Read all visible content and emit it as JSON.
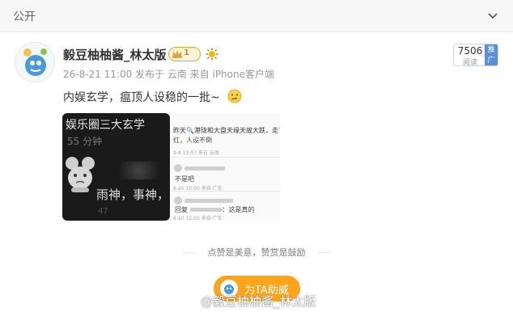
{
  "visibility": "公开",
  "user": {
    "name": "毅豆柚柚酱_林太版",
    "crown_level": "1"
  },
  "post": {
    "meta": "26-8-21 11:00 发布于 云南  来自 iPhone客户端",
    "text": "内娱玄学，瘟顶人设稳的一批~",
    "images": [
      {
        "title": "娱乐圈三大玄学",
        "sub": "55 分钟",
        "caption": "雨神，事神，",
        "foot": "47"
      },
      {
        "line1": "昨天🔍港珑和大盘天缘天故大跌，走了",
        "line1b": "红，人设不倒",
        "meta1": "9-8 13:07 来自 云南",
        "line2": "不是吧",
        "meta2": "8-20 10:00 来自 广东",
        "line3": "回复 ",
        "line3b": "：这是真的",
        "meta3": "8-20 12:00 来自 广东"
      }
    ]
  },
  "reads": {
    "count": "7506",
    "label": "阅读",
    "button": "推广"
  },
  "divider_text": "点赞是美意，赞赏是鼓励",
  "boost_label": "为TA助威",
  "watermark": "@毅豆柚柚酱_林太版",
  "icons": {
    "chevron": "chevron-down-icon",
    "crown": "crown-icon",
    "emoji": "thinking-face-icon",
    "sun": "sun-icon"
  },
  "colors": {
    "accent": "#ffa31a",
    "link": "#5b8fd6"
  }
}
